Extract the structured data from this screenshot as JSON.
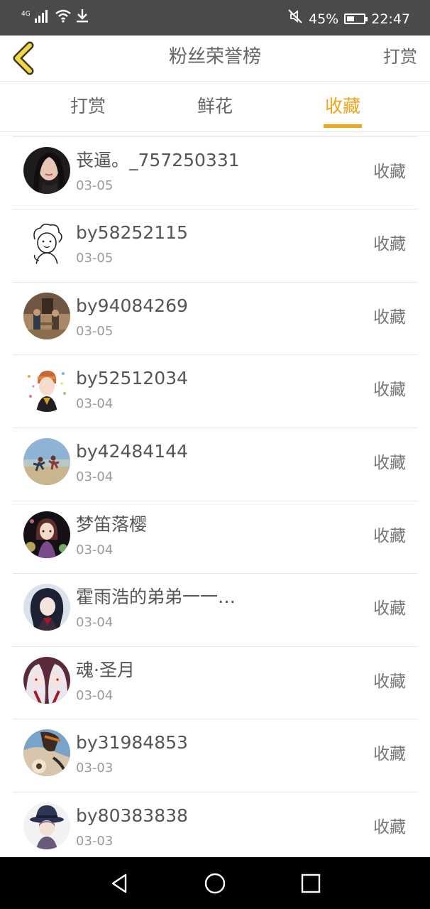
{
  "status_bar": {
    "network": "4G",
    "battery_percent": "45%",
    "battery_level": 0.45,
    "time": "22:47"
  },
  "header": {
    "title": "粉丝荣誉榜",
    "right_action": "打赏"
  },
  "tabs": [
    {
      "label": "打赏",
      "active": false
    },
    {
      "label": "鲜花",
      "active": false
    },
    {
      "label": "收藏",
      "active": true
    }
  ],
  "colors": {
    "accent": "#f0a419",
    "status_bar": "#4a4a4a"
  },
  "fans": [
    {
      "name": "丧逼。_757250331",
      "date": "03-05",
      "action": "收藏"
    },
    {
      "name": "by58252115",
      "date": "03-05",
      "action": "收藏"
    },
    {
      "name": "by94084269",
      "date": "03-05",
      "action": "收藏"
    },
    {
      "name": "by52512034",
      "date": "03-04",
      "action": "收藏"
    },
    {
      "name": "by42484144",
      "date": "03-04",
      "action": "收藏"
    },
    {
      "name": "梦笛落樱",
      "date": "03-04",
      "action": "收藏"
    },
    {
      "name": "霍雨浩的弟弟一一…",
      "date": "03-04",
      "action": "收藏"
    },
    {
      "name": "魂·圣月",
      "date": "03-04",
      "action": "收藏"
    },
    {
      "name": "by31984853",
      "date": "03-03",
      "action": "收藏"
    },
    {
      "name": "by80383838",
      "date": "03-03",
      "action": "收藏"
    }
  ],
  "icons": {
    "back": "chevron-left-icon",
    "nav_back": "triangle-back-icon",
    "nav_home": "circle-home-icon",
    "nav_recents": "square-recents-icon"
  }
}
